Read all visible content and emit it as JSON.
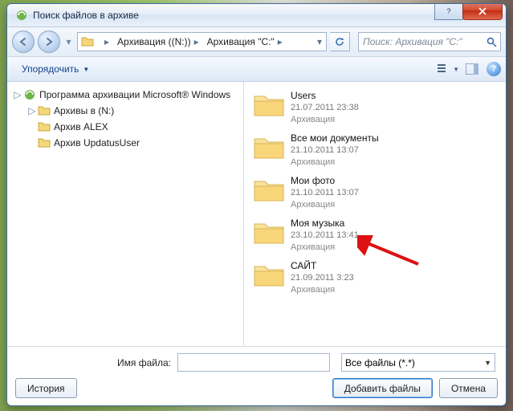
{
  "window": {
    "title": "Поиск файлов в архиве"
  },
  "breadcrumb": {
    "items": [
      "",
      "Архивация ((N:))",
      "Архивация \"C:\""
    ]
  },
  "search": {
    "placeholder": "Поиск: Архивация \"C:\""
  },
  "toolbar": {
    "organize": "Упорядочить"
  },
  "tree": {
    "root": {
      "label": "Программа архивации Microsoft® Windows"
    },
    "items": [
      {
        "label": "Архивы в (N:)"
      },
      {
        "label": "Архив ALEX"
      },
      {
        "label": "Архив UpdatusUser"
      }
    ]
  },
  "files": [
    {
      "name": "Users",
      "date": "21.07.2011 23:38",
      "type": "Архивация"
    },
    {
      "name": "Все мои документы",
      "date": "21.10.2011 13:07",
      "type": "Архивация"
    },
    {
      "name": "Мои фото",
      "date": "21.10.2011 13:07",
      "type": "Архивация"
    },
    {
      "name": "Моя музыка",
      "date": "23.10.2011 13:41",
      "type": "Архивация"
    },
    {
      "name": "САЙТ",
      "date": "21.09.2011 3:23",
      "type": "Архивация"
    }
  ],
  "footer": {
    "filename_label": "Имя файла:",
    "filter": "Все файлы (*.*)",
    "history": "История",
    "add": "Добавить файлы",
    "cancel": "Отмена"
  }
}
